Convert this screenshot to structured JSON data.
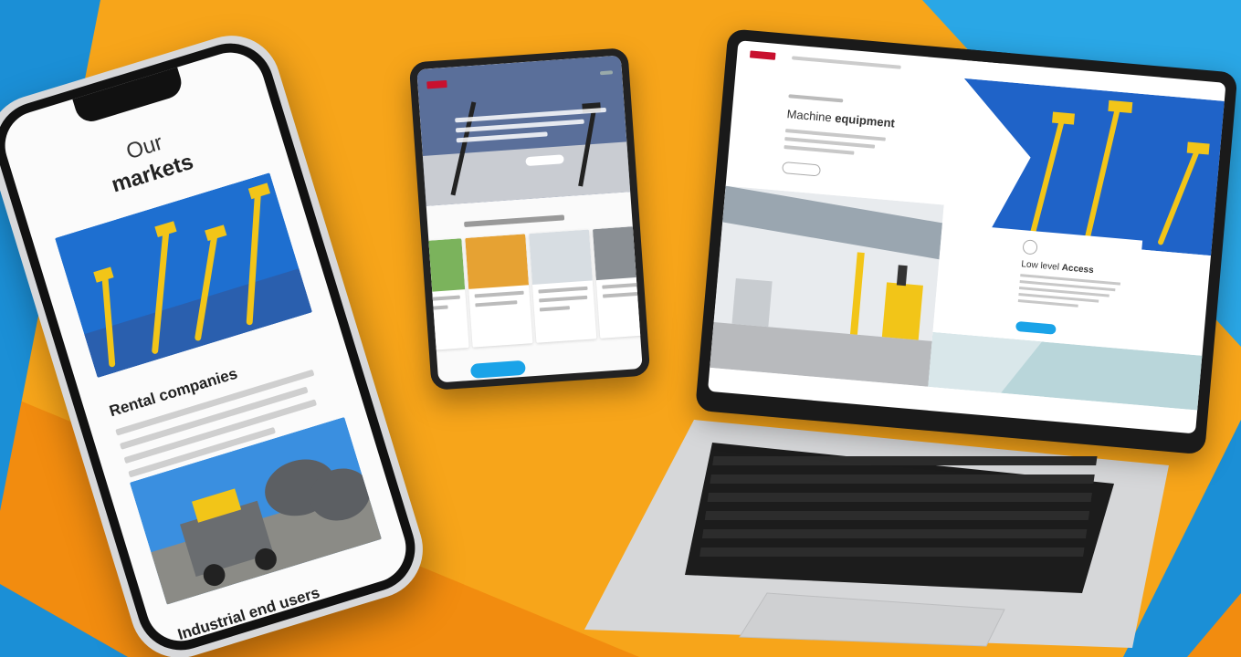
{
  "scene": {
    "colors": {
      "orange": "#f7a51a",
      "orange_deep": "#f28c0f",
      "blue": "#1b8fd6",
      "blue_light": "#2aa7e6",
      "brand_red": "#c8102e",
      "cta_blue": "#1aa3e8",
      "lift_yellow": "#f2c518"
    }
  },
  "phone": {
    "title_line1": "Our",
    "title_line2": "markets",
    "section1_heading": "Rental companies",
    "section2_heading": "Industrial end users"
  },
  "laptop": {
    "hero_title_light": "Machine",
    "hero_title_bold": "equipment",
    "card_title_light": "Low level",
    "card_title_bold": "Access"
  }
}
